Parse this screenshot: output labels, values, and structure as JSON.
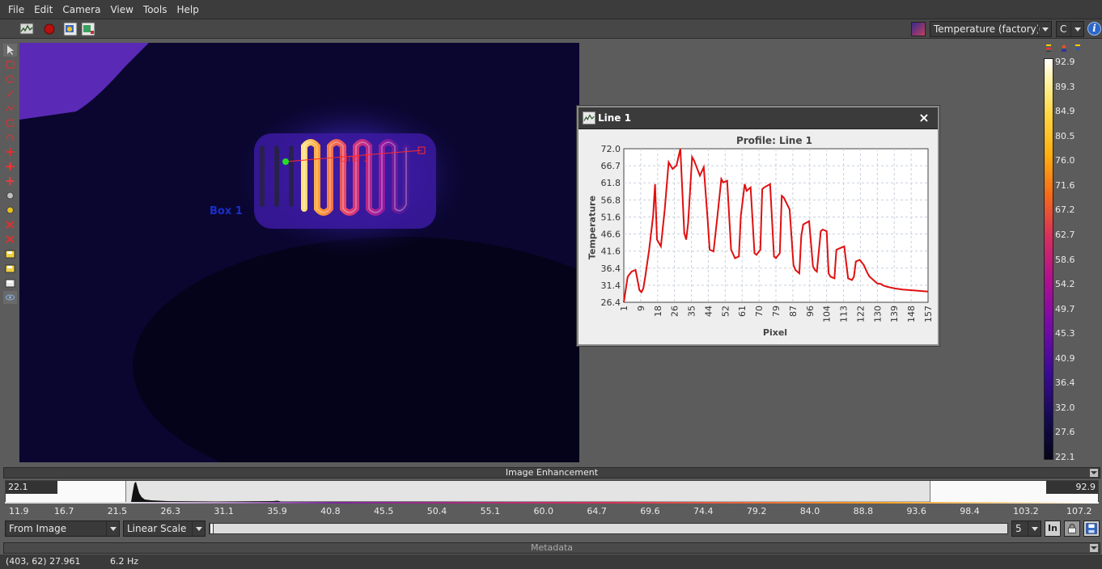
{
  "menu": [
    "File",
    "Edit",
    "Camera",
    "View",
    "Tools",
    "Help"
  ],
  "toolbar": {
    "icons": [
      "line-profile-icon",
      "record-icon",
      "snapshot-icon",
      "snapshot-settings-icon"
    ],
    "palette_icon": "palette-icon",
    "palette": "Temperature (factory)",
    "unit": "C",
    "info_icon": "i"
  },
  "tools": [
    "select-arrow-icon",
    "rectangle-tool-icon",
    "ellipse-tool-icon",
    "line-tool-icon",
    "polyline-tool-icon",
    "polygon-tool-icon",
    "freeform-tool-icon",
    "spot-tool-icon",
    "hot-spot-icon",
    "cold-spot-icon",
    "spot-difference-icon",
    "color-picker-icon",
    "delete-roi-icon",
    "delete-all-icon",
    "open-roi-icon",
    "export-roi-icon",
    "save-roi-icon",
    "view-roi-icon"
  ],
  "image": {
    "box_label": "Box 1",
    "line_label": "Line 1"
  },
  "profile": {
    "window_title": "Line 1",
    "close": "×",
    "chart_title": "Profile: Line 1",
    "xlabel": "Pixel",
    "ylabel": "Temperature"
  },
  "chart_data": {
    "type": "line",
    "title": "Profile: Line 1",
    "xlabel": "Pixel",
    "ylabel": "Temperature",
    "xlim": [
      1,
      157
    ],
    "ylim": [
      26.4,
      72.0
    ],
    "yticks": [
      "72.0",
      "66.7",
      "61.8",
      "56.8",
      "51.6",
      "46.6",
      "41.6",
      "36.4",
      "31.4",
      "26.4"
    ],
    "xticks": [
      "1",
      "9",
      "18",
      "26",
      "35",
      "44",
      "52",
      "61",
      "70",
      "79",
      "87",
      "96",
      "104",
      "113",
      "122",
      "130",
      "139",
      "148",
      "157"
    ],
    "grid": true,
    "color": "#e01010",
    "x": [
      1,
      3,
      5,
      7,
      9,
      10,
      11,
      12,
      14,
      16,
      17,
      18,
      20,
      22,
      24,
      26,
      28,
      30,
      32,
      33,
      34,
      36,
      37,
      38,
      40,
      42,
      44,
      45,
      47,
      49,
      51,
      52,
      54,
      56,
      58,
      60,
      61,
      63,
      64,
      66,
      68,
      69,
      71,
      72,
      73,
      76,
      78,
      79,
      81,
      82,
      83,
      86,
      88,
      89,
      91,
      92,
      93,
      96,
      98,
      99,
      100,
      102,
      103,
      105,
      106,
      107,
      109,
      110,
      112,
      114,
      116,
      118,
      119,
      120,
      122,
      124,
      126,
      127,
      128,
      130,
      131,
      133,
      134,
      136,
      140,
      144,
      148,
      152,
      157
    ],
    "y": [
      26.4,
      34.0,
      35.5,
      36.0,
      30.0,
      29.4,
      30.5,
      34.0,
      42.0,
      52.0,
      61.5,
      45.0,
      43.0,
      54.0,
      68.0,
      66.0,
      67.0,
      72.0,
      47.0,
      45.0,
      50.0,
      69.5,
      68.5,
      67.0,
      64.0,
      66.5,
      51.0,
      42.0,
      41.5,
      52.0,
      63.0,
      62.0,
      62.5,
      42.0,
      39.5,
      40.0,
      52.0,
      61.5,
      59.5,
      60.5,
      41.0,
      40.5,
      42.0,
      60.0,
      60.5,
      61.5,
      40.0,
      39.5,
      41.0,
      58.0,
      57.5,
      54.0,
      37.5,
      36.0,
      35.0,
      46.0,
      49.5,
      50.5,
      37.0,
      36.0,
      35.5,
      47.5,
      48.0,
      47.5,
      35.0,
      34.0,
      33.5,
      42.0,
      42.5,
      43.0,
      33.5,
      33.0,
      34.0,
      38.5,
      39.0,
      37.5,
      35.0,
      34.0,
      33.5,
      32.5,
      32.0,
      31.8,
      31.4,
      31.0,
      30.5,
      30.2,
      30.0,
      29.8,
      29.6
    ]
  },
  "colorbar": {
    "ticks": [
      "92.9",
      "89.3",
      "84.9",
      "80.5",
      "76.0",
      "71.6",
      "67.2",
      "62.7",
      "58.6",
      "54.2",
      "49.7",
      "45.3",
      "40.9",
      "36.4",
      "32.0",
      "27.6",
      "22.1"
    ],
    "icons": [
      "max-marker-icon",
      "center-marker-icon",
      "min-marker-icon"
    ]
  },
  "enhancement": {
    "title": "Image Enhancement",
    "min_value": "22.1",
    "max_value": "92.9",
    "scale_ticks": [
      "11.9",
      "16.7",
      "21.5",
      "26.3",
      "31.1",
      "35.9",
      "40.8",
      "45.5",
      "50.4",
      "55.1",
      "60.0",
      "64.7",
      "69.6",
      "74.4",
      "79.2",
      "84.0",
      "88.8",
      "93.6",
      "98.4",
      "103.2",
      "107.2"
    ],
    "source": "From Image",
    "scale": "Linear Scale",
    "step": "5",
    "in_label": "In"
  },
  "metadata": {
    "title": "Metadata"
  },
  "status": {
    "coords": "(403, 62) 27.961",
    "rate": "6.2 Hz"
  }
}
